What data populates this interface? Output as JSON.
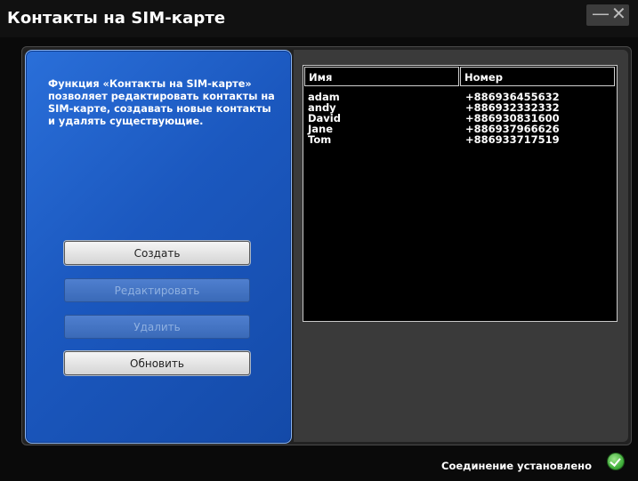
{
  "window": {
    "title": "Контакты на SIM-карте",
    "minimize_symbol": "—",
    "close_symbol": "✕"
  },
  "sidebar": {
    "description": "Функция «Контакты на SIM-карте» позволяет редактировать контакты на SIM-карте, создавать новые контакты и удалять существующие.",
    "buttons": {
      "create": {
        "label": "Создать",
        "enabled": true
      },
      "edit": {
        "label": "Редактировать",
        "enabled": false
      },
      "delete": {
        "label": "Удалить",
        "enabled": false
      },
      "refresh": {
        "label": "Обновить",
        "enabled": true
      }
    }
  },
  "contacts_table": {
    "headers": {
      "name": "Имя",
      "number": "Номер"
    },
    "rows": [
      {
        "name": "adam",
        "number": "+886936455632"
      },
      {
        "name": "andy",
        "number": "+886932332332"
      },
      {
        "name": "David",
        "number": "+886930831600"
      },
      {
        "name": "Jane",
        "number": "+886937966626"
      },
      {
        "name": "Tom",
        "number": "+886933717519"
      }
    ]
  },
  "status": {
    "text": "Соединение установлено",
    "icon": "check-circle-icon",
    "color": "#4cbf3a"
  }
}
